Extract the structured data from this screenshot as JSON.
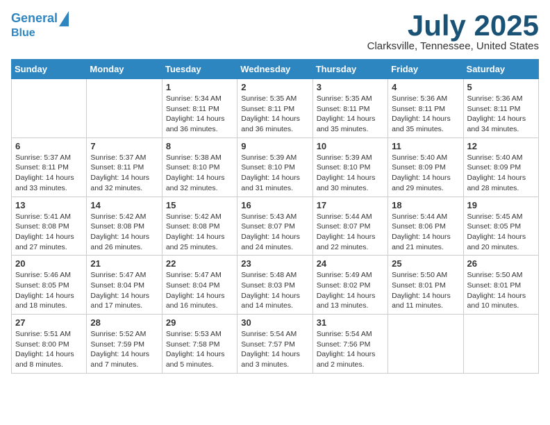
{
  "header": {
    "logo_line1": "General",
    "logo_line2": "Blue",
    "month_title": "July 2025",
    "location": "Clarksville, Tennessee, United States"
  },
  "weekdays": [
    "Sunday",
    "Monday",
    "Tuesday",
    "Wednesday",
    "Thursday",
    "Friday",
    "Saturday"
  ],
  "weeks": [
    [
      {
        "day": "",
        "content": ""
      },
      {
        "day": "",
        "content": ""
      },
      {
        "day": "1",
        "content": "Sunrise: 5:34 AM\nSunset: 8:11 PM\nDaylight: 14 hours and 36 minutes."
      },
      {
        "day": "2",
        "content": "Sunrise: 5:35 AM\nSunset: 8:11 PM\nDaylight: 14 hours and 36 minutes."
      },
      {
        "day": "3",
        "content": "Sunrise: 5:35 AM\nSunset: 8:11 PM\nDaylight: 14 hours and 35 minutes."
      },
      {
        "day": "4",
        "content": "Sunrise: 5:36 AM\nSunset: 8:11 PM\nDaylight: 14 hours and 35 minutes."
      },
      {
        "day": "5",
        "content": "Sunrise: 5:36 AM\nSunset: 8:11 PM\nDaylight: 14 hours and 34 minutes."
      }
    ],
    [
      {
        "day": "6",
        "content": "Sunrise: 5:37 AM\nSunset: 8:11 PM\nDaylight: 14 hours and 33 minutes."
      },
      {
        "day": "7",
        "content": "Sunrise: 5:37 AM\nSunset: 8:11 PM\nDaylight: 14 hours and 32 minutes."
      },
      {
        "day": "8",
        "content": "Sunrise: 5:38 AM\nSunset: 8:10 PM\nDaylight: 14 hours and 32 minutes."
      },
      {
        "day": "9",
        "content": "Sunrise: 5:39 AM\nSunset: 8:10 PM\nDaylight: 14 hours and 31 minutes."
      },
      {
        "day": "10",
        "content": "Sunrise: 5:39 AM\nSunset: 8:10 PM\nDaylight: 14 hours and 30 minutes."
      },
      {
        "day": "11",
        "content": "Sunrise: 5:40 AM\nSunset: 8:09 PM\nDaylight: 14 hours and 29 minutes."
      },
      {
        "day": "12",
        "content": "Sunrise: 5:40 AM\nSunset: 8:09 PM\nDaylight: 14 hours and 28 minutes."
      }
    ],
    [
      {
        "day": "13",
        "content": "Sunrise: 5:41 AM\nSunset: 8:08 PM\nDaylight: 14 hours and 27 minutes."
      },
      {
        "day": "14",
        "content": "Sunrise: 5:42 AM\nSunset: 8:08 PM\nDaylight: 14 hours and 26 minutes."
      },
      {
        "day": "15",
        "content": "Sunrise: 5:42 AM\nSunset: 8:08 PM\nDaylight: 14 hours and 25 minutes."
      },
      {
        "day": "16",
        "content": "Sunrise: 5:43 AM\nSunset: 8:07 PM\nDaylight: 14 hours and 24 minutes."
      },
      {
        "day": "17",
        "content": "Sunrise: 5:44 AM\nSunset: 8:07 PM\nDaylight: 14 hours and 22 minutes."
      },
      {
        "day": "18",
        "content": "Sunrise: 5:44 AM\nSunset: 8:06 PM\nDaylight: 14 hours and 21 minutes."
      },
      {
        "day": "19",
        "content": "Sunrise: 5:45 AM\nSunset: 8:05 PM\nDaylight: 14 hours and 20 minutes."
      }
    ],
    [
      {
        "day": "20",
        "content": "Sunrise: 5:46 AM\nSunset: 8:05 PM\nDaylight: 14 hours and 18 minutes."
      },
      {
        "day": "21",
        "content": "Sunrise: 5:47 AM\nSunset: 8:04 PM\nDaylight: 14 hours and 17 minutes."
      },
      {
        "day": "22",
        "content": "Sunrise: 5:47 AM\nSunset: 8:04 PM\nDaylight: 14 hours and 16 minutes."
      },
      {
        "day": "23",
        "content": "Sunrise: 5:48 AM\nSunset: 8:03 PM\nDaylight: 14 hours and 14 minutes."
      },
      {
        "day": "24",
        "content": "Sunrise: 5:49 AM\nSunset: 8:02 PM\nDaylight: 14 hours and 13 minutes."
      },
      {
        "day": "25",
        "content": "Sunrise: 5:50 AM\nSunset: 8:01 PM\nDaylight: 14 hours and 11 minutes."
      },
      {
        "day": "26",
        "content": "Sunrise: 5:50 AM\nSunset: 8:01 PM\nDaylight: 14 hours and 10 minutes."
      }
    ],
    [
      {
        "day": "27",
        "content": "Sunrise: 5:51 AM\nSunset: 8:00 PM\nDaylight: 14 hours and 8 minutes."
      },
      {
        "day": "28",
        "content": "Sunrise: 5:52 AM\nSunset: 7:59 PM\nDaylight: 14 hours and 7 minutes."
      },
      {
        "day": "29",
        "content": "Sunrise: 5:53 AM\nSunset: 7:58 PM\nDaylight: 14 hours and 5 minutes."
      },
      {
        "day": "30",
        "content": "Sunrise: 5:54 AM\nSunset: 7:57 PM\nDaylight: 14 hours and 3 minutes."
      },
      {
        "day": "31",
        "content": "Sunrise: 5:54 AM\nSunset: 7:56 PM\nDaylight: 14 hours and 2 minutes."
      },
      {
        "day": "",
        "content": ""
      },
      {
        "day": "",
        "content": ""
      }
    ]
  ]
}
